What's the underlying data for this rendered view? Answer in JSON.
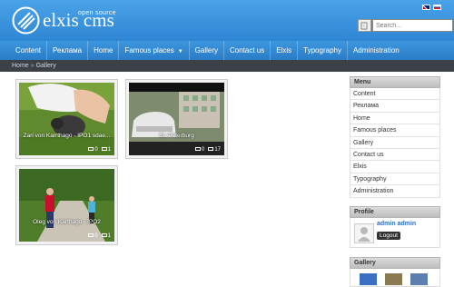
{
  "header": {
    "brand_name": "elxis cms",
    "brand_tag": "open source",
    "search": {
      "placeholder": "Search..."
    },
    "languages": [
      "en",
      "ru"
    ]
  },
  "nav": {
    "items": [
      {
        "label": "Content"
      },
      {
        "label": "Реклама"
      },
      {
        "label": "Home"
      },
      {
        "label": "Famous places",
        "has_submenu": true
      },
      {
        "label": "Gallery"
      },
      {
        "label": "Contact us"
      },
      {
        "label": "Elxis"
      },
      {
        "label": "Typography"
      },
      {
        "label": "Administration"
      }
    ]
  },
  "breadcrumb": {
    "items": [
      "Home",
      "Gallery"
    ],
    "separator": "»"
  },
  "gallery": {
    "items": [
      {
        "caption": "Zari von Karrthago - IPO1 sdae...",
        "images": "0",
        "comments": "1"
      },
      {
        "caption": "St.-Peterburg",
        "images": "0",
        "comments": "17"
      },
      {
        "caption": "Oleg von Karthago - IPO2",
        "images": "0",
        "comments": "1"
      }
    ]
  },
  "sidebar": {
    "menu": {
      "title": "Menu",
      "items": [
        "Content",
        "Реклама",
        "Home",
        "Famous places",
        "Gallery",
        "Contact us",
        "Elxis",
        "Typography",
        "Administration"
      ]
    },
    "profile": {
      "title": "Profile",
      "name": "admin admin",
      "logout_label": "Logout"
    },
    "gallery": {
      "title": "Gallery"
    }
  },
  "colors": {
    "header_blue": "#3a95de",
    "breadcrumb_bg": "#3b4147",
    "link_blue": "#2f6ebf"
  }
}
